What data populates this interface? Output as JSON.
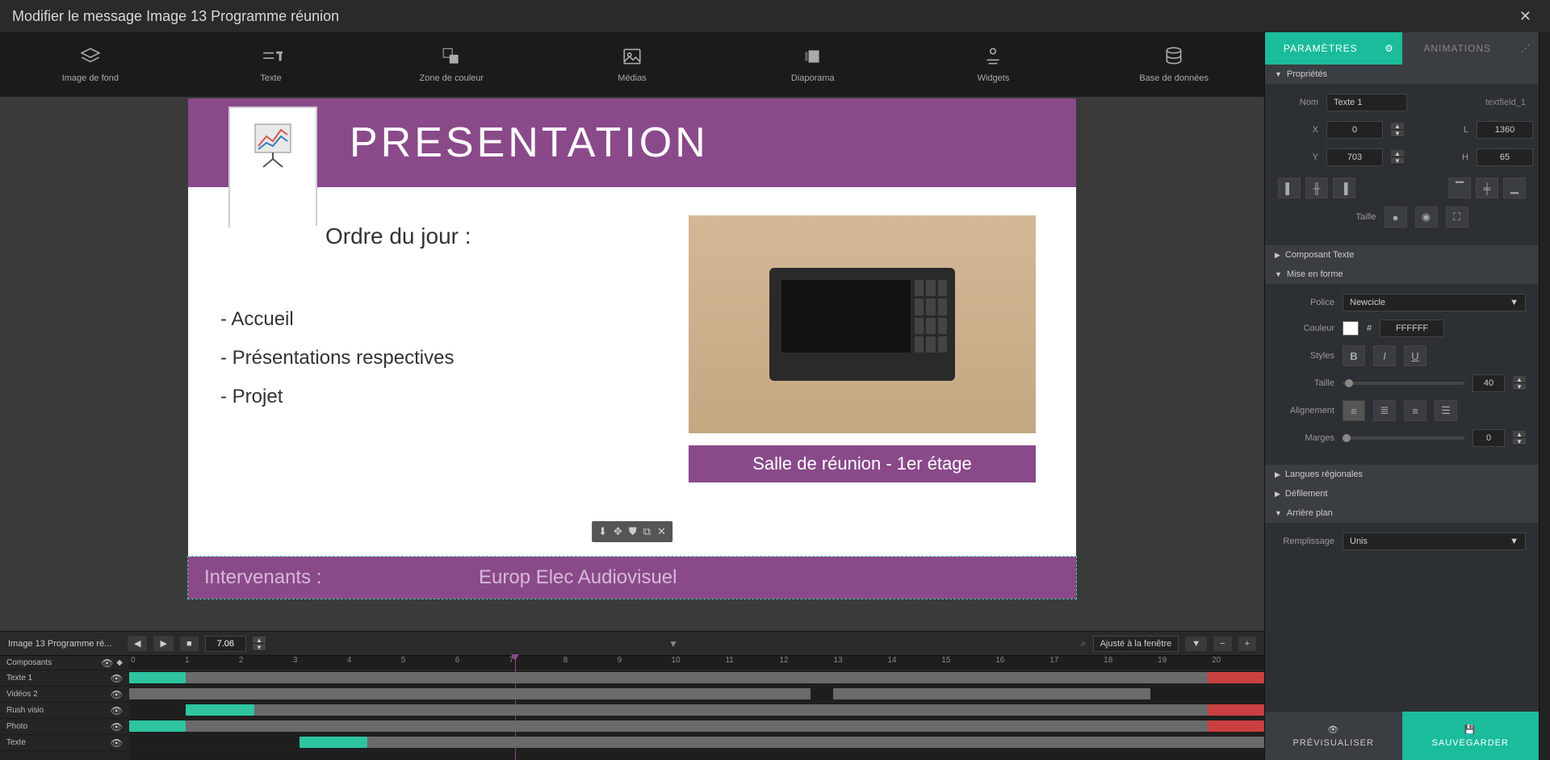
{
  "titlebar": {
    "title": "Modifier le message Image 13 Programme réunion"
  },
  "toolbar": {
    "items": [
      {
        "label": "Image de fond"
      },
      {
        "label": "Texte"
      },
      {
        "label": "Zone de couleur"
      },
      {
        "label": "Médias"
      },
      {
        "label": "Diaporama"
      },
      {
        "label": "Widgets"
      },
      {
        "label": "Base de données"
      }
    ]
  },
  "slide": {
    "header": "PRESENTATION",
    "agenda_title": "Ordre du jour :",
    "items": [
      "Accueil",
      "Présentations respectives",
      "Projet"
    ],
    "caption": "Salle de réunion - 1er étage",
    "speakers_label": "Intervenants :",
    "speakers_value": "Europ Elec Audiovisuel"
  },
  "timeline": {
    "name": "Image 13 Programme ré...",
    "time": "7.06",
    "zoom": "Ajusté à la fenêtre",
    "ruler": [
      "0",
      "1",
      "2",
      "3",
      "4",
      "5",
      "6",
      "7",
      "8",
      "9",
      "10",
      "11",
      "12",
      "13",
      "14",
      "15",
      "16",
      "17",
      "18",
      "19",
      "20"
    ],
    "rows": [
      {
        "label": "Composants"
      },
      {
        "label": "Texte 1"
      },
      {
        "label": "Vidéos 2"
      },
      {
        "label": "Rush visio"
      },
      {
        "label": "Photo"
      },
      {
        "label": "Texte"
      }
    ]
  },
  "panel": {
    "tabs": {
      "params": "PARAMÈTRES",
      "anim": "ANIMATIONS"
    },
    "sections": {
      "props": "Propriétés",
      "textcomp": "Composant Texte",
      "format": "Mise en forme",
      "regional": "Langues régionales",
      "scroll": "Défilement",
      "bg": "Arrière plan"
    },
    "props": {
      "name_label": "Nom",
      "name_value": "Texte 1",
      "id": "textfield_1",
      "x_label": "X",
      "x": "0",
      "y_label": "Y",
      "y": "703",
      "l_label": "L",
      "l": "1360",
      "h_label": "H",
      "h": "65",
      "size_label": "Taille"
    },
    "format": {
      "font_label": "Police",
      "font": "Newcicle",
      "color_label": "Couleur",
      "color_hex": "FFFFFF",
      "styles_label": "Styles",
      "size_label": "Taille",
      "size": "40",
      "align_label": "Alignement",
      "margin_label": "Marges",
      "margin": "0"
    },
    "bg": {
      "fill_label": "Remplissage",
      "fill": "Unis"
    }
  },
  "actions": {
    "preview": "PRÉVISUALISER",
    "save": "SAUVEGARDER"
  }
}
